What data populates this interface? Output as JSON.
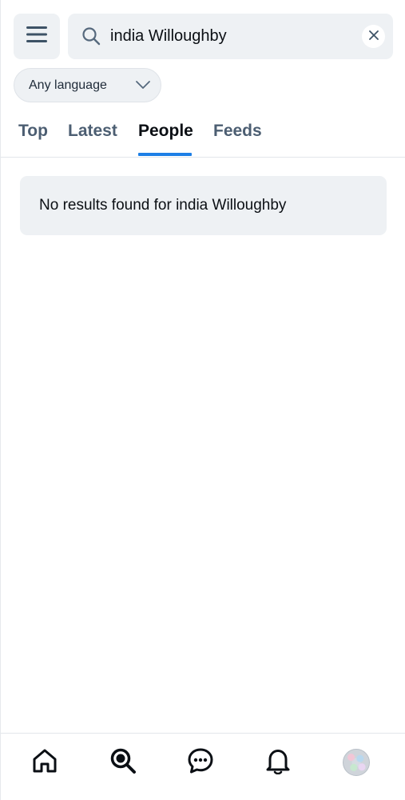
{
  "header": {
    "menu_icon": "hamburger-menu-icon",
    "search": {
      "value": "india Willoughby",
      "search_icon": "magnifier-icon",
      "clear_icon": "close-icon"
    },
    "language_filter": {
      "selected": "Any language",
      "icon": "chevron-down-icon"
    }
  },
  "tabs": [
    {
      "label": "Top",
      "active": false
    },
    {
      "label": "Latest",
      "active": false
    },
    {
      "label": "People",
      "active": true
    },
    {
      "label": "Feeds",
      "active": false
    }
  ],
  "results": {
    "empty_message": "No results found for india Willoughby"
  },
  "bottom_nav": {
    "items": [
      "home-icon",
      "search-icon",
      "chat-icon",
      "bell-icon",
      "avatar"
    ]
  },
  "colors": {
    "accent": "#1d7fe6",
    "surface": "#eef1f4",
    "inactive_tab": "#4c5e72",
    "text": "#0b0f14"
  }
}
